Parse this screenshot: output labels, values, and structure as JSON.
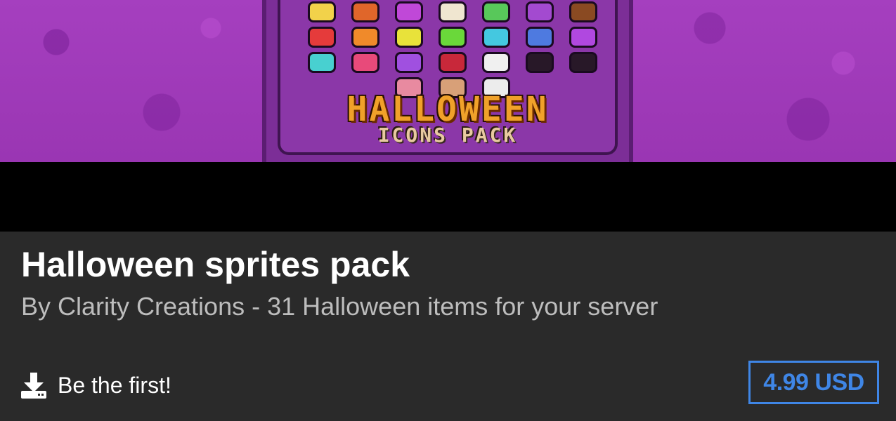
{
  "banner": {
    "pack_title": "HALLOWEEN",
    "pack_subtitle": "ICONS PACK",
    "sprite_colors": [
      [
        "#f2d24a",
        "#e0662a",
        "#c048d8",
        "#f0e6d0",
        "#58c85a",
        "#a34ad0",
        "#8a4a22"
      ],
      [
        "#e53b3b",
        "#f08a2a",
        "#e8e23a",
        "#6ad83a",
        "#44c8e0",
        "#4e7ae0",
        "#b048e0"
      ],
      [
        "#48d0d0",
        "#e84a7a",
        "#a050e0",
        "#c8283a",
        "#f0f0f0",
        "#281828",
        "#281828"
      ],
      [
        "#e88aa0",
        "#d8a078",
        "#ececec"
      ]
    ]
  },
  "product": {
    "title": "Halloween sprites pack",
    "subtitle": "By Clarity Creations - 31 Halloween items for your server",
    "downloads_label": "Be the first!",
    "price": "4.99 USD",
    "download_icon": "download-icon"
  },
  "colors": {
    "accent": "#3f86e6",
    "background": "#2a2a2a",
    "banner_purple": "#a53fbf"
  }
}
